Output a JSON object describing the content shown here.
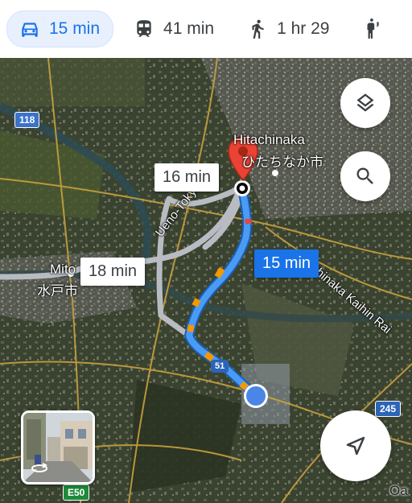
{
  "travel_modes": [
    {
      "icon": "car-icon",
      "label": "15 min",
      "active": true
    },
    {
      "icon": "train-icon",
      "label": "41 min",
      "active": false
    },
    {
      "icon": "walk-icon",
      "label": "1 hr 29",
      "active": false
    },
    {
      "icon": "rideshare-icon",
      "label": "",
      "active": false
    }
  ],
  "map": {
    "place_labels": {
      "hitachinaka_en": "Hitachinaka",
      "hitachinaka_jp": "ひたちなか市",
      "mito_en": "Mito",
      "mito_jp": "水戸市",
      "rail_line_1": "Ueno-Tokyo Line",
      "rail_line_2": "hinaka Kaihin Rai",
      "area_bottom_right": "Oa"
    },
    "road_shields": {
      "route_118": "118",
      "route_51": "51",
      "route_245": "245",
      "expressway": "E50"
    },
    "route_times": {
      "primary": "15 min",
      "alt_1": "16 min",
      "alt_2": "18 min"
    }
  },
  "colors": {
    "accent": "#1a73e8",
    "route_blue": "#4a9bf5",
    "traffic_orange": "#f29900",
    "traffic_red": "#e8453c",
    "alt_route_gray": "#b8bcc2",
    "destination_pin": "#ea4335"
  },
  "controls": {
    "layers_icon": "layers-icon",
    "search_icon": "search-icon",
    "recenter_icon": "navigation-arrow-icon",
    "street_view_icon": "rotate-360-icon"
  }
}
